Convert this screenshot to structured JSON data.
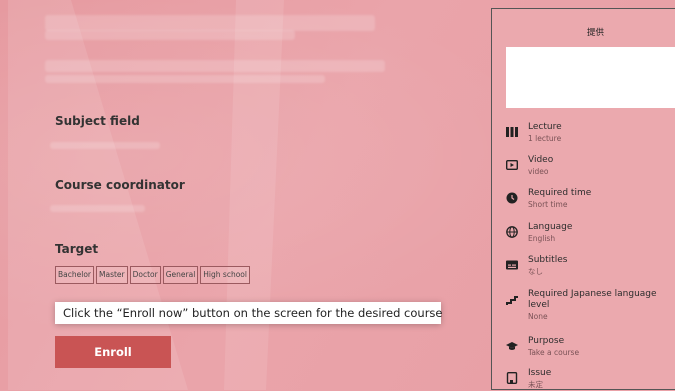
{
  "left": {
    "subject_field_label": "Subject field",
    "course_coordinator_label": "Course coordinator",
    "target_label": "Target",
    "target_tags": [
      "Bachelor",
      "Master",
      "Doctor",
      "General",
      "High school"
    ],
    "tooltip_text": "Click the “Enroll now” button on the screen for the desired course",
    "enroll_label": "Enroll"
  },
  "panel": {
    "title": "提供",
    "features": [
      {
        "icon": "bars-icon",
        "title": "Lecture",
        "value": "1 lecture"
      },
      {
        "icon": "video-icon",
        "title": "Video",
        "value": "video"
      },
      {
        "icon": "clock-icon",
        "title": "Required time",
        "value": "Short time"
      },
      {
        "icon": "globe-icon",
        "title": "Language",
        "value": "English"
      },
      {
        "icon": "subtitles-icon",
        "title": "Subtitles",
        "value": "なし"
      },
      {
        "icon": "stairs-icon",
        "title": "Required Japanese language level",
        "value": "None"
      },
      {
        "icon": "graduation-cap-icon",
        "title": "Purpose",
        "value": "Take a course"
      },
      {
        "icon": "certificate-icon",
        "title": "Issue",
        "value": "未定"
      }
    ]
  },
  "colors": {
    "background": "#e9a2a8",
    "enroll_button": "#c95454"
  }
}
